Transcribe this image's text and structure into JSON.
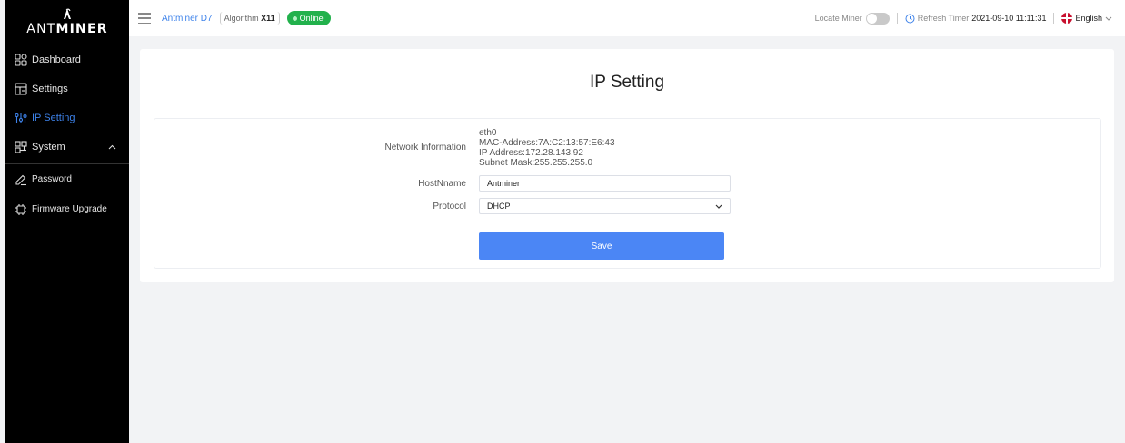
{
  "logo": {
    "text_light": "ANT",
    "text_bold": "MINER"
  },
  "sidebar": {
    "items": [
      {
        "label": "Dashboard",
        "icon": "dashboard-icon"
      },
      {
        "label": "Settings",
        "icon": "settings-icon"
      },
      {
        "label": "IP Setting",
        "icon": "sliders-icon",
        "active": true
      },
      {
        "label": "System",
        "icon": "system-icon",
        "expanded": true
      }
    ],
    "sub_items": [
      {
        "label": "Password",
        "icon": "edit-icon"
      },
      {
        "label": "Firmware Upgrade",
        "icon": "chip-icon"
      }
    ]
  },
  "header": {
    "miner_name": "Antminer D7",
    "algorithm_label": "Algorithm",
    "algorithm_value": "X11",
    "status": "Online",
    "locate_miner_label": "Locate Miner",
    "locate_miner_on": false,
    "refresh_label": "Refresh Timer",
    "refresh_time": "2021-09-10 11:11:31",
    "language": "English"
  },
  "main": {
    "title": "IP Setting",
    "network_info_label": "Network Information",
    "network_info": {
      "interface": "eth0",
      "mac": "MAC-Address:7A:C2:13:57:E6:43",
      "ip": "IP Address:172.28.143.92",
      "subnet": "Subnet Mask:255.255.255.0"
    },
    "hostname_label": "HostNname",
    "hostname_value": "Antminer",
    "protocol_label": "Protocol",
    "protocol_value": "DHCP",
    "save_label": "Save"
  },
  "colors": {
    "accent": "#3d82ea",
    "save_button": "#4b86f5",
    "status_online": "#22b14c",
    "sidebar_bg": "#000000",
    "page_bg": "#f2f3f5"
  }
}
